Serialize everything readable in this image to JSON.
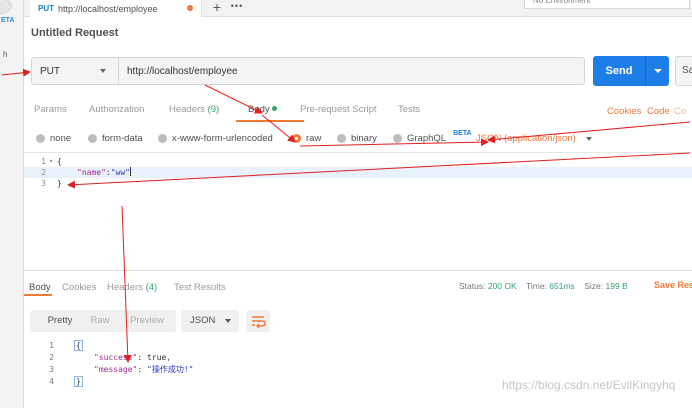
{
  "left_strip": {
    "beta_label": "ETA",
    "partial_text": "h"
  },
  "tab": {
    "method": "PUT",
    "url": "http://localhost/employee"
  },
  "tabbar": {
    "add_label": "+",
    "more_label": "•••",
    "environment": "No Environment"
  },
  "request": {
    "title": "Untitled Request",
    "method": "PUT",
    "url": "http://localhost/employee",
    "send_label": "Send",
    "save_label": "Sa"
  },
  "request_tabs": {
    "params": "Params",
    "authorization": "Authorization",
    "headers": "Headers",
    "headers_count": "(9)",
    "body": "Body",
    "prerequest": "Pre-request Script",
    "tests": "Tests",
    "cookies": "Cookies",
    "code": "Code",
    "comments": "Co"
  },
  "body_types": {
    "none": "none",
    "form_data": "form-data",
    "urlencoded": "x-www-form-urlencoded",
    "raw": "raw",
    "binary": "binary",
    "graphql": "GraphQL",
    "graphql_badge": "BETA",
    "content_type": "JSON (application/json)"
  },
  "editor": {
    "line_numbers": [
      "1",
      "2",
      "3"
    ],
    "line1": "{",
    "key": "\"name\"",
    "colon": ":",
    "value": "\"ww\"",
    "line3": "}"
  },
  "response_tabs": {
    "body": "Body",
    "cookies": "Cookies",
    "headers": "Headers",
    "headers_count": "(4)",
    "test_results": "Test Results"
  },
  "status": {
    "status_label": "Status:",
    "status_value": "200 OK",
    "time_label": "Time:",
    "time_value": "651ms",
    "size_label": "Size:",
    "size_value": "199 B",
    "save_response": "Save Res"
  },
  "response_view": {
    "pretty": "Pretty",
    "raw": "Raw",
    "preview": "Preview",
    "format": "JSON"
  },
  "response_code": {
    "line_numbers": [
      "1",
      "2",
      "3",
      "4"
    ],
    "line1": "{",
    "success_key": "\"success\"",
    "success_value": "true,",
    "message_key": "\"message\"",
    "message_value": "\"操作成功!\"",
    "line4": "}"
  },
  "watermark": "https://blog.csdn.net/EvilKingyhq",
  "colors": {
    "accent_orange": "#f27839",
    "send_blue": "#1e7ee8",
    "status_green": "#38a36e",
    "annotation_red": "#e02020"
  }
}
